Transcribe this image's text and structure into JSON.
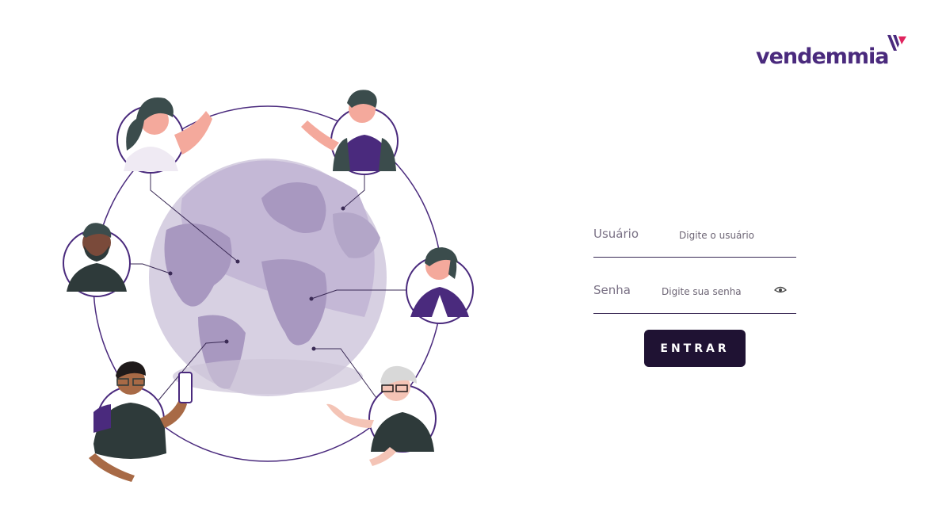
{
  "brand": {
    "name": "vendemmia",
    "primary_color": "#4a2a7d",
    "accent_color": "#e0245e"
  },
  "illustration": {
    "description_icon": "globe-network-illustration"
  },
  "login": {
    "username_label": "Usuário",
    "username_placeholder": "Digite o usuário",
    "password_label": "Senha",
    "password_placeholder": "Digite sua senha",
    "toggle_password_icon": "eye-icon",
    "submit_label": "ENTRAR",
    "button_color": "#1f1233"
  }
}
